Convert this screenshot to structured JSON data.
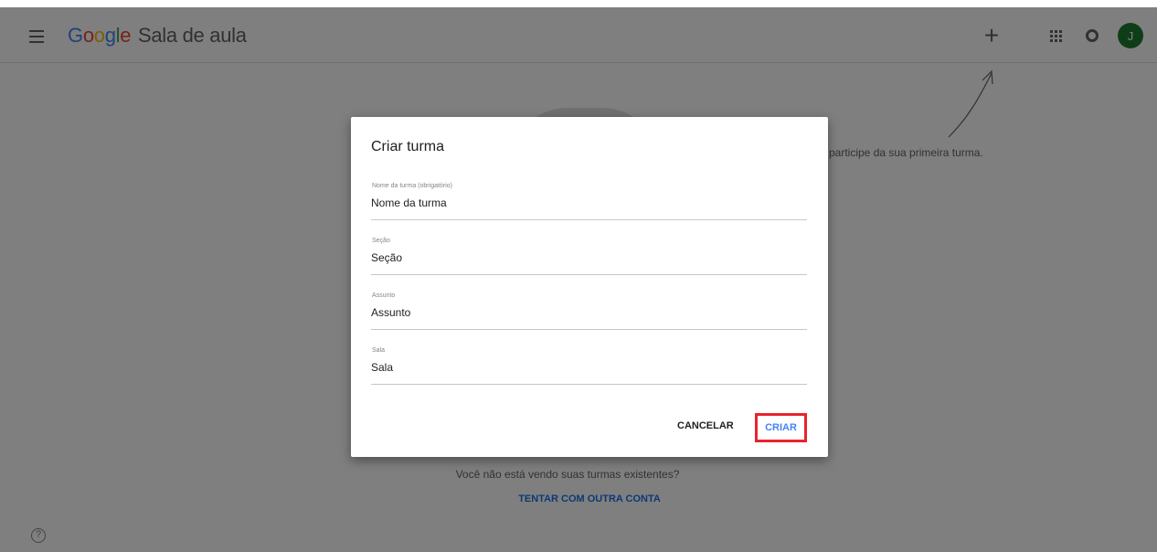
{
  "app": {
    "brand_google": "Google",
    "brand_name": "Sala de aula",
    "avatar_initial": "J"
  },
  "page": {
    "hint_text": "participe da sua primeira turma.",
    "existing_question": "Você não está vendo suas turmas existentes?",
    "try_other_account": "TENTAR COM OUTRA CONTA",
    "help_symbol": "?"
  },
  "dialog": {
    "title": "Criar turma",
    "fields": [
      {
        "label": "Nome da turma (obrigatório)",
        "placeholder": "Nome da turma"
      },
      {
        "label": "Seção",
        "placeholder": "Seção"
      },
      {
        "label": "Assunto",
        "placeholder": "Assunto"
      },
      {
        "label": "Sala",
        "placeholder": "Sala"
      }
    ],
    "cancel_label": "CANCELAR",
    "create_label": "CRIAR"
  },
  "colors": {
    "accent": "#1a73e8",
    "highlight": "#e8232e",
    "avatar": "#1e7a2e"
  }
}
